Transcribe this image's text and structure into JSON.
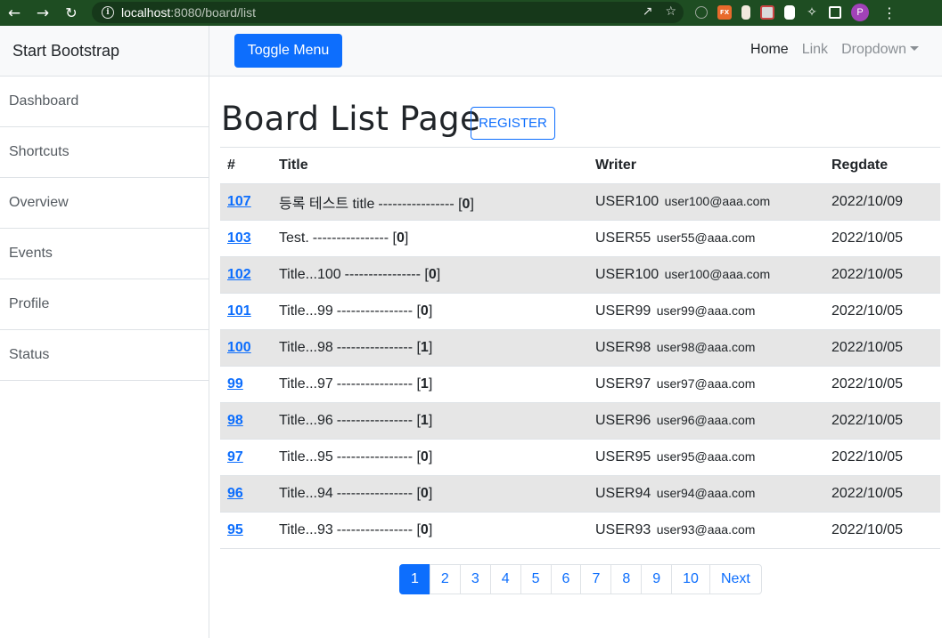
{
  "browser": {
    "url_host": "localhost",
    "url_rest": ":8080/board/list",
    "back_icon": "back-arrow-icon",
    "forward_icon": "forward-arrow-icon",
    "reload_icon": "reload-icon",
    "profile_initial": "P"
  },
  "sidebar": {
    "heading": "Start Bootstrap",
    "items": [
      {
        "label": "Dashboard"
      },
      {
        "label": "Shortcuts"
      },
      {
        "label": "Overview"
      },
      {
        "label": "Events"
      },
      {
        "label": "Profile"
      },
      {
        "label": "Status"
      }
    ]
  },
  "navbar": {
    "toggle_label": "Toggle Menu",
    "links": [
      {
        "label": "Home"
      },
      {
        "label": "Link"
      },
      {
        "label": "Dropdown"
      }
    ]
  },
  "main": {
    "title": "Board List Page",
    "register_label": "REGISTER",
    "table": {
      "headers": [
        "#",
        "Title",
        "Writer",
        "Regdate"
      ],
      "rows": [
        {
          "bno": "107",
          "title": "등록 테스트 title",
          "dashes": "----------------",
          "replies": "0",
          "writer": "USER100",
          "email": "user100@aaa.com",
          "regdate": "2022/10/09"
        },
        {
          "bno": "103",
          "title": "Test.",
          "dashes": "----------------",
          "replies": "0",
          "writer": "USER55",
          "email": "user55@aaa.com",
          "regdate": "2022/10/05"
        },
        {
          "bno": "102",
          "title": "Title...100",
          "dashes": "----------------",
          "replies": "0",
          "writer": "USER100",
          "email": "user100@aaa.com",
          "regdate": "2022/10/05"
        },
        {
          "bno": "101",
          "title": "Title...99",
          "dashes": "----------------",
          "replies": "0",
          "writer": "USER99",
          "email": "user99@aaa.com",
          "regdate": "2022/10/05"
        },
        {
          "bno": "100",
          "title": "Title...98",
          "dashes": "----------------",
          "replies": "1",
          "writer": "USER98",
          "email": "user98@aaa.com",
          "regdate": "2022/10/05"
        },
        {
          "bno": "99",
          "title": "Title...97",
          "dashes": "----------------",
          "replies": "1",
          "writer": "USER97",
          "email": "user97@aaa.com",
          "regdate": "2022/10/05"
        },
        {
          "bno": "98",
          "title": "Title...96",
          "dashes": "----------------",
          "replies": "1",
          "writer": "USER96",
          "email": "user96@aaa.com",
          "regdate": "2022/10/05"
        },
        {
          "bno": "97",
          "title": "Title...95",
          "dashes": "----------------",
          "replies": "0",
          "writer": "USER95",
          "email": "user95@aaa.com",
          "regdate": "2022/10/05"
        },
        {
          "bno": "96",
          "title": "Title...94",
          "dashes": "----------------",
          "replies": "0",
          "writer": "USER94",
          "email": "user94@aaa.com",
          "regdate": "2022/10/05"
        },
        {
          "bno": "95",
          "title": "Title...93",
          "dashes": "----------------",
          "replies": "0",
          "writer": "USER93",
          "email": "user93@aaa.com",
          "regdate": "2022/10/05"
        }
      ]
    },
    "pagination": {
      "pages": [
        "1",
        "2",
        "3",
        "4",
        "5",
        "6",
        "7",
        "8",
        "9",
        "10"
      ],
      "active_page": "1",
      "next_label": "Next"
    }
  },
  "colors": {
    "primary": "#0d6efd",
    "browser_bar": "#1e4d22",
    "stripe": "#e6e6e6"
  }
}
